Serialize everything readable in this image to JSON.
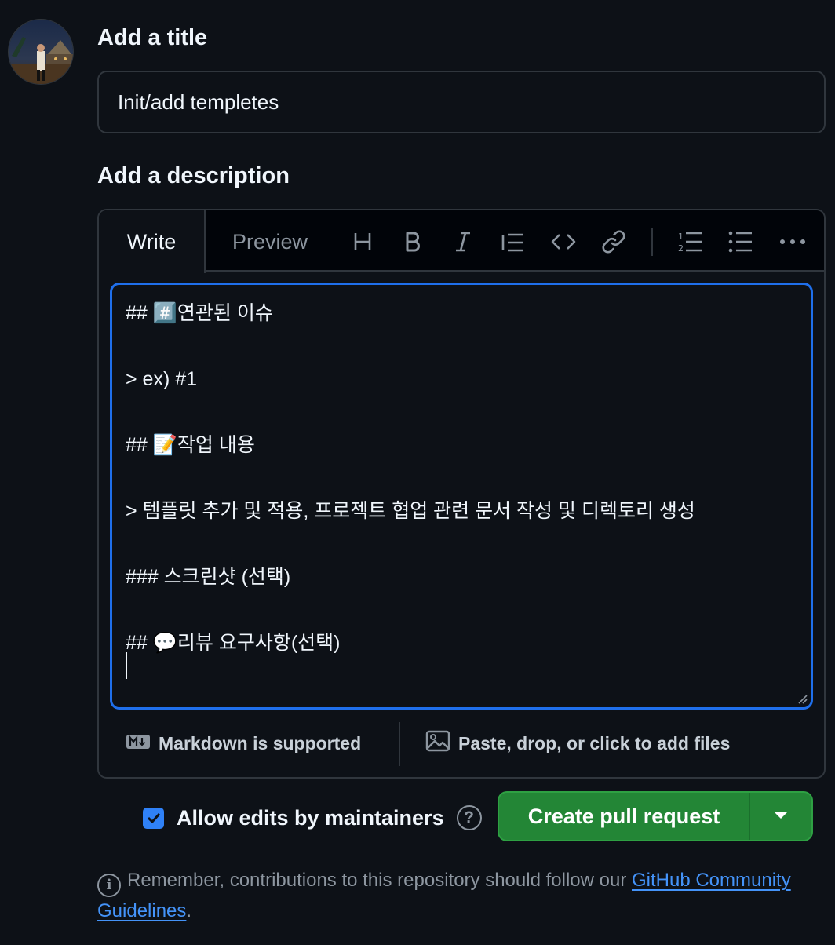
{
  "title_section": {
    "label": "Add a title",
    "value": "Init/add templetes"
  },
  "description_section": {
    "label": "Add a description"
  },
  "editor": {
    "tabs": {
      "write": "Write",
      "preview": "Preview"
    },
    "toolbar_icons": [
      "heading-icon",
      "bold-icon",
      "italic-icon",
      "quote-icon",
      "code-icon",
      "link-icon",
      "ordered-list-icon",
      "unordered-list-icon",
      "more-icon"
    ],
    "lines": [
      "## #️⃣연관된 이슈",
      "> ex) #1",
      "## 📝작업 내용",
      "> 템플릿 추가 및 적용, 프로젝트 협업 관련 문서 작성 및 디렉토리 생성",
      "### 스크린샷 (선택)",
      "## 💬리뷰 요구사항(선택)"
    ],
    "footer": {
      "markdown": "Markdown is supported",
      "attach": "Paste, drop, or click to add files"
    }
  },
  "allow_edits": {
    "label": "Allow edits by maintainers",
    "checked": true
  },
  "create_button": {
    "label": "Create pull request"
  },
  "note": {
    "text": "Remember, contributions to this repository should follow our ",
    "link": "GitHub Community Guidelines",
    "suffix": "."
  },
  "colors": {
    "background": "#0d1117",
    "border": "#30363d",
    "focus": "#1f6feb",
    "primary_button": "#238636",
    "link": "#4493f8"
  }
}
